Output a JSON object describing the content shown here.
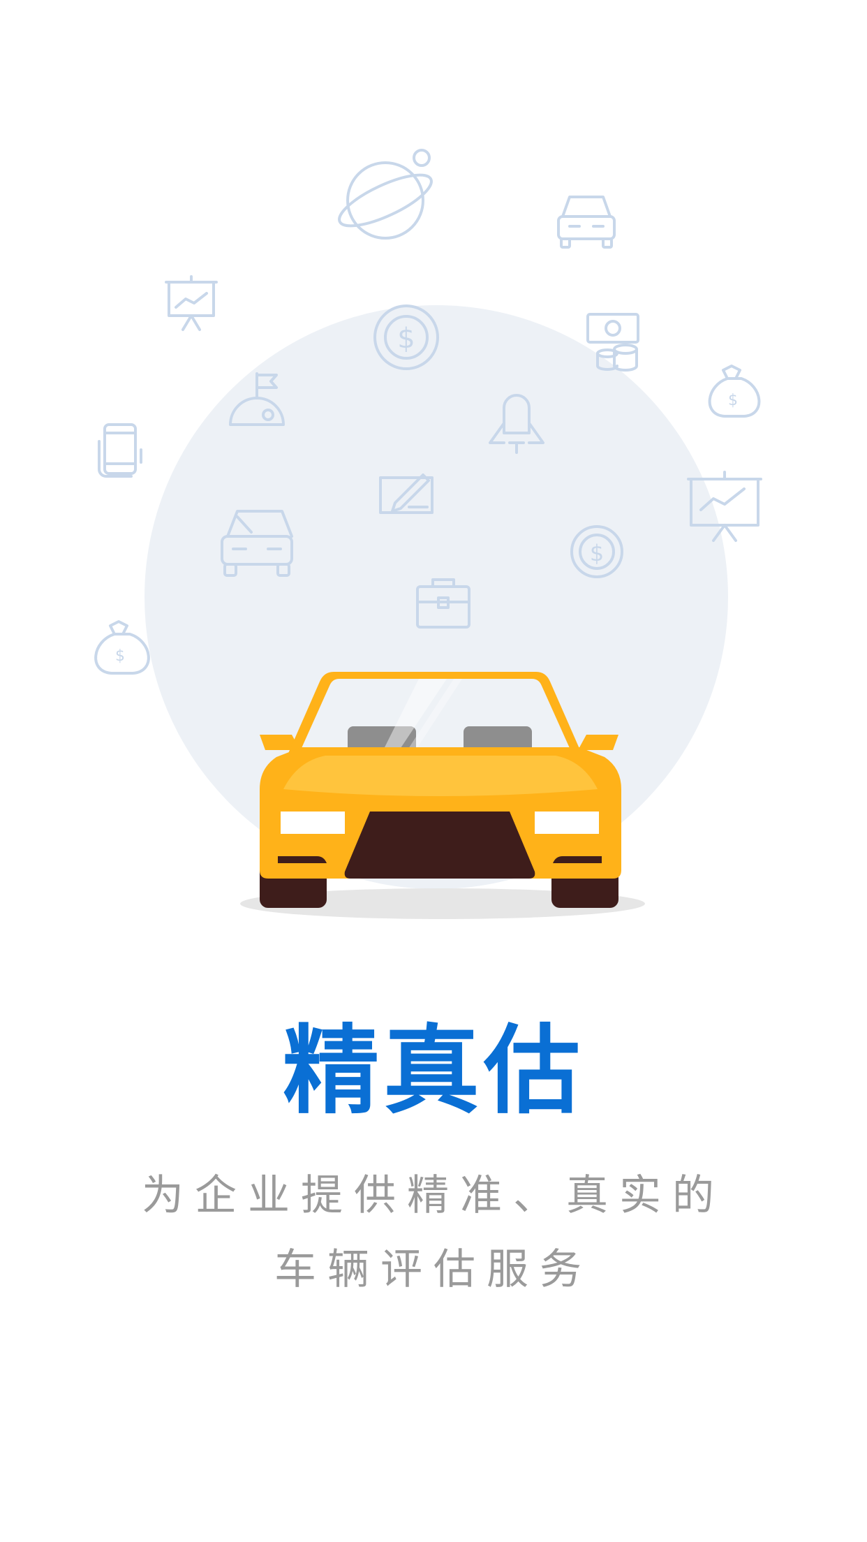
{
  "onboarding": {
    "title": "精真估",
    "subtitle_line1": "为企业提供精准、真实的",
    "subtitle_line2": "车辆评估服务"
  },
  "illustration": {
    "main_object": "yellow-car-front-view",
    "background_icons": [
      "planet-icon",
      "car-outline-icon",
      "presentation-chart-icon",
      "dollar-coin-icon",
      "cash-stack-icon",
      "money-bag-icon",
      "flag-on-planet-icon",
      "rocket-icon",
      "smartphone-icon",
      "contract-pen-icon",
      "briefcase-icon"
    ]
  },
  "colors": {
    "title": "#0a6fd4",
    "subtitle": "#9a9a9a",
    "icon_stroke": "#c8d7ea",
    "circle": "#edf1f6",
    "car_body": "#ffb219",
    "car_dark": "#3e1d1b"
  }
}
